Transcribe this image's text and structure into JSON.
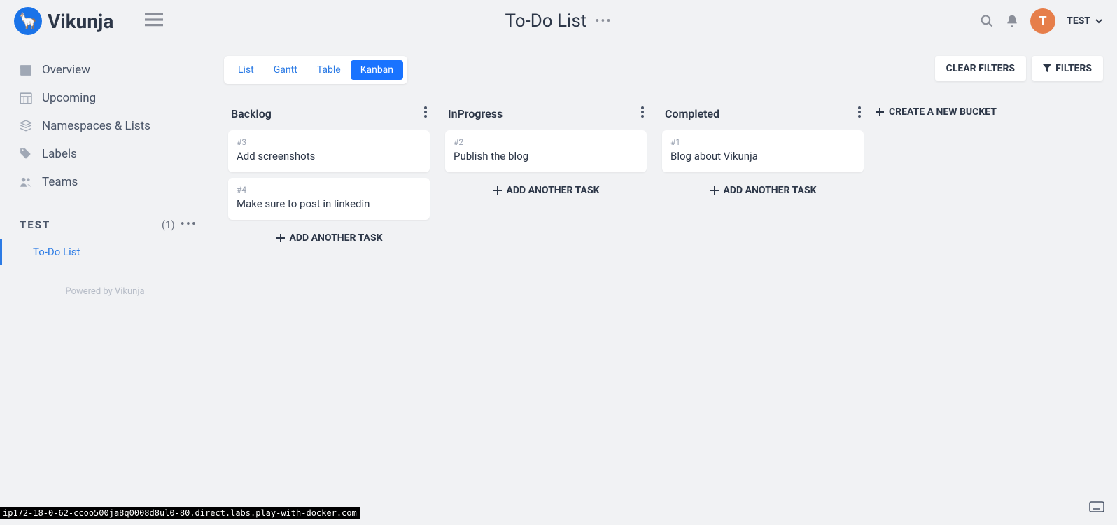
{
  "app": {
    "name": "Vikunja"
  },
  "header": {
    "page_title": "To-Do List",
    "user_name": "TEST",
    "user_initial": "T"
  },
  "sidebar": {
    "items": [
      {
        "label": "Overview"
      },
      {
        "label": "Upcoming"
      },
      {
        "label": "Namespaces & Lists"
      },
      {
        "label": "Labels"
      },
      {
        "label": "Teams"
      }
    ],
    "namespace": {
      "title": "TEST",
      "count": "(1)"
    },
    "lists": [
      {
        "label": "To-Do List"
      }
    ],
    "powered": "Powered by Vikunja"
  },
  "views": {
    "tabs": [
      "List",
      "Gantt",
      "Table",
      "Kanban"
    ],
    "active": "Kanban"
  },
  "filters": {
    "clear": "CLEAR FILTERS",
    "filters": "FILTERS"
  },
  "board": {
    "add_task": "ADD ANOTHER TASK",
    "new_bucket": "CREATE A NEW BUCKET",
    "buckets": [
      {
        "title": "Backlog",
        "cards": [
          {
            "id": "#3",
            "title": "Add screenshots"
          },
          {
            "id": "#4",
            "title": "Make sure to post in linkedin"
          }
        ]
      },
      {
        "title": "InProgress",
        "cards": [
          {
            "id": "#2",
            "title": "Publish the blog"
          }
        ]
      },
      {
        "title": "Completed",
        "cards": [
          {
            "id": "#1",
            "title": "Blog about Vikunja"
          }
        ]
      }
    ]
  },
  "status_url": "ip172-18-0-62-ccoo500ja8q0008d8ul0-80.direct.labs.play-with-docker.com"
}
